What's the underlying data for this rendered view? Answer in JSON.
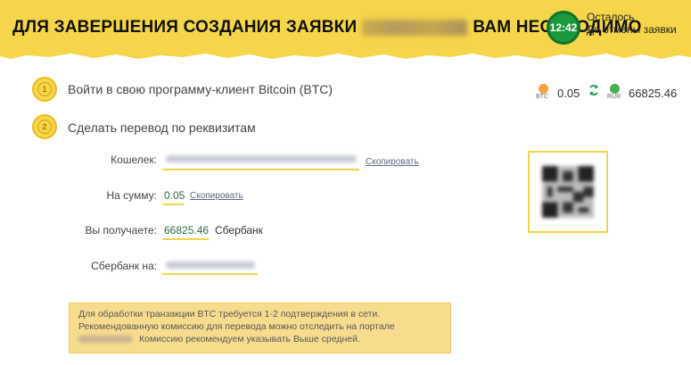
{
  "banner": {
    "title_left": "ДЛЯ ЗАВЕРШЕНИЯ СОЗДАНИЯ ЗАЯВКИ",
    "title_right": "ВАМ НЕОБХОДИМО",
    "timer": "12:42",
    "remaining_line1": "Осталось",
    "remaining_line2": "До отмены заявки",
    "colors": {
      "yellow": "#f5d64a",
      "timer_green": "#1a9a3a"
    }
  },
  "steps": [
    {
      "number": "1",
      "label": "Войти в свою программу-клиент Bitcoin (BTC)"
    },
    {
      "number": "2",
      "label": "Сделать перевод по реквизитам"
    }
  ],
  "rates": {
    "btc_code": "BTC",
    "btc_value": "0.05",
    "rur_code": "RUR",
    "rur_value": "66825.46"
  },
  "form": {
    "wallet_label": "Кошелек:",
    "copy_label": "Скопировать",
    "amount_label": "На сумму:",
    "amount_value": "0.05",
    "receive_label": "Вы получаете:",
    "receive_value": "66825.46",
    "receive_bank": "Сбербанк",
    "sber_label": "Сбербанк на:"
  },
  "info": {
    "line1": "Для обработки транзакции BTC требуется 1-2 подтверждения в сети.",
    "line2": "Рекомендованную комиссию для перевода можно отследить на портале",
    "line3": "Комиссию рекомендуем указывать Выше средней."
  }
}
